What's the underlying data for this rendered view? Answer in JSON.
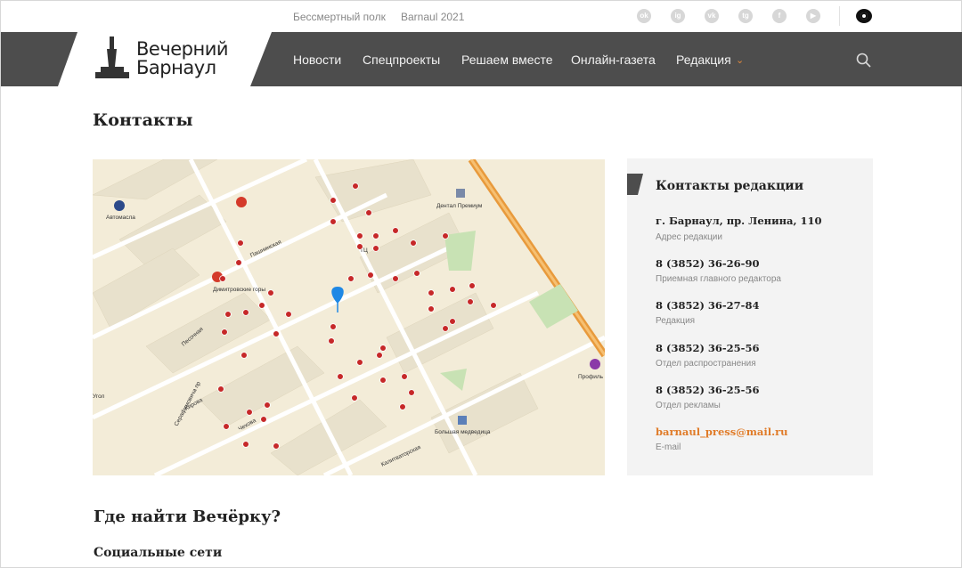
{
  "topbar": {
    "links": [
      "Бессмертный полк",
      "Barnaul 2021"
    ],
    "social_icons": [
      "odnoklassniki-icon",
      "instagram-icon",
      "vk-icon",
      "telegram-icon",
      "facebook-icon",
      "youtube-icon"
    ],
    "accessibility_icon": "eye-icon"
  },
  "logo": {
    "line1": "Вечерний",
    "line2": "Барнаул"
  },
  "nav": {
    "items": [
      "Новости",
      "Спецпроекты",
      "Решаем вместе",
      "Онлайн-газета",
      "Редакция"
    ],
    "accent": "#e48a3c"
  },
  "page": {
    "title": "Контакты"
  },
  "map": {
    "labels": {
      "automasla": "Автомасла",
      "dimitrov": "Димитровские горы",
      "dental": "Дентал Премиум",
      "medic": "Большая медведица",
      "prof": "Профиль",
      "lagutina": "Пашнинская",
      "pesochnaya": "Песочная",
      "kirova": "Кирова",
      "chehova": "Чехова",
      "ugol": "Угол",
      "sportsm": "Серафимовича пр",
      "kalita": "Калитваторская",
      "tc": "ТЦ"
    }
  },
  "contacts": {
    "title": "Контакты редакции",
    "items": [
      {
        "value": "г. Барнаул, пр. Ленина, 110",
        "label": "Адрес редакции"
      },
      {
        "value": "8 (3852) 36-26-90",
        "label": "Приемная главного редактора"
      },
      {
        "value": "8 (3852) 36-27-84",
        "label": "Редакция"
      },
      {
        "value": "8 (3852) 36-25-56",
        "label": "Отдел распространения"
      },
      {
        "value": "8 (3852) 36-25-56",
        "label": "Отдел рекламы"
      },
      {
        "value": "barnaul_press@mail.ru",
        "label": "E-mail"
      }
    ],
    "email_color": "#e07b28"
  },
  "where": {
    "title": "Где найти Вечёрку?",
    "social_title": "Социальные сети"
  }
}
